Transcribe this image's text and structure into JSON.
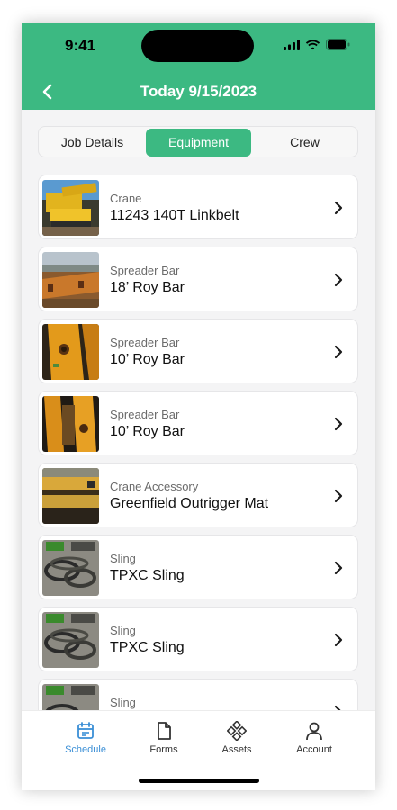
{
  "status_bar": {
    "time": "9:41"
  },
  "header": {
    "title": "Today 9/15/2023",
    "back_icon": "chevron-left-icon"
  },
  "colors": {
    "brand": "#3cb982",
    "active_tab": "#3b8fd6"
  },
  "tabs": [
    {
      "label": "Job Details",
      "active": false
    },
    {
      "label": "Equipment",
      "active": true
    },
    {
      "label": "Crew",
      "active": false
    }
  ],
  "equipment": [
    {
      "category": "Crane",
      "name": "11243 140T Linkbelt",
      "thumb": "crane"
    },
    {
      "category": "Spreader Bar",
      "name": "18’ Roy Bar",
      "thumb": "bar-yard"
    },
    {
      "category": "Spreader Bar",
      "name": "10’ Roy Bar",
      "thumb": "bar-closeup"
    },
    {
      "category": "Spreader Bar",
      "name": "10’ Roy Bar",
      "thumb": "bar-side"
    },
    {
      "category": "Crane Accessory",
      "name": "Greenfield Outrigger Mat",
      "thumb": "mat"
    },
    {
      "category": "Sling",
      "name": "TPXC Sling",
      "thumb": "sling"
    },
    {
      "category": "Sling",
      "name": "TPXC Sling",
      "thumb": "sling"
    },
    {
      "category": "Sling",
      "name": "",
      "thumb": "sling"
    }
  ],
  "tabbar": [
    {
      "label": "Schedule",
      "icon": "calendar-icon",
      "active": true
    },
    {
      "label": "Forms",
      "icon": "document-icon",
      "active": false
    },
    {
      "label": "Assets",
      "icon": "assets-icon",
      "active": false
    },
    {
      "label": "Account",
      "icon": "person-icon",
      "active": false
    }
  ]
}
